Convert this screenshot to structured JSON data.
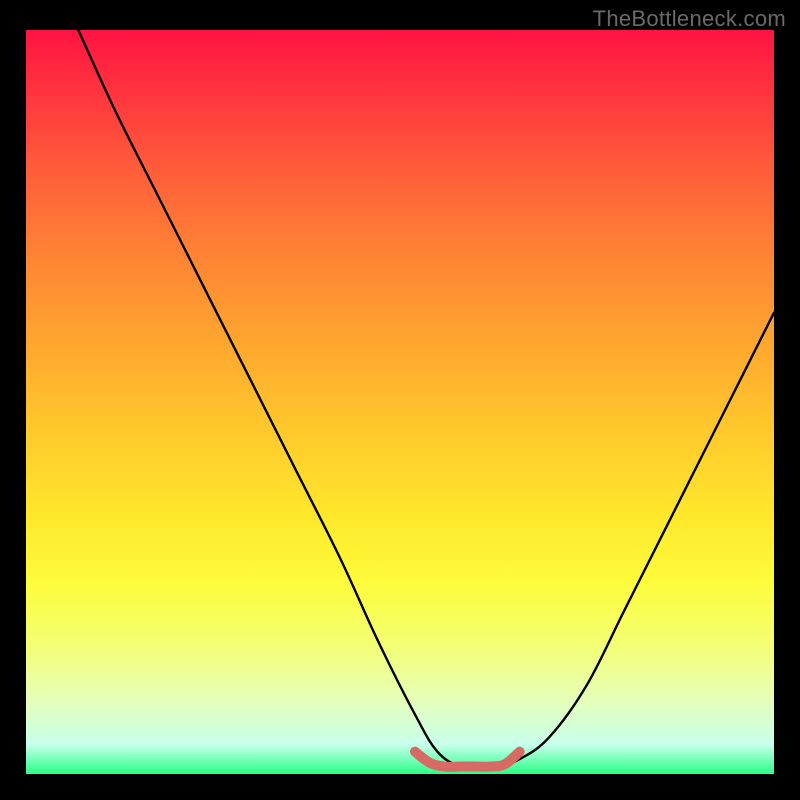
{
  "watermark": "TheBottleneck.com",
  "chart_data": {
    "type": "line",
    "title": "",
    "xlabel": "",
    "ylabel": "",
    "xlim": [
      0,
      100
    ],
    "ylim": [
      0,
      100
    ],
    "series": [
      {
        "name": "bottleneck-curve",
        "color": "#000000",
        "x": [
          7,
          12,
          18,
          24,
          30,
          36,
          42,
          47,
          52,
          55,
          58,
          60,
          63,
          66,
          70,
          75,
          80,
          86,
          92,
          100
        ],
        "y": [
          100,
          89,
          77,
          65,
          53,
          41,
          29,
          18,
          8,
          3,
          1,
          1,
          1,
          2,
          5,
          12,
          22,
          34,
          46,
          62
        ]
      },
      {
        "name": "optimal-band",
        "color": "#d86a66",
        "x": [
          52,
          54,
          56,
          58,
          60,
          62,
          64,
          66
        ],
        "y": [
          3.0,
          1.5,
          1.0,
          1.0,
          1.0,
          1.0,
          1.3,
          3.0
        ]
      }
    ],
    "gradient_stops": [
      {
        "pos": 0.0,
        "color": "#ff1342"
      },
      {
        "pos": 0.07,
        "color": "#ff2f3e"
      },
      {
        "pos": 0.18,
        "color": "#ff5a3b"
      },
      {
        "pos": 0.3,
        "color": "#ff8334"
      },
      {
        "pos": 0.42,
        "color": "#ffa62f"
      },
      {
        "pos": 0.54,
        "color": "#ffc92c"
      },
      {
        "pos": 0.65,
        "color": "#ffe72b"
      },
      {
        "pos": 0.74,
        "color": "#fdfb3a"
      },
      {
        "pos": 0.82,
        "color": "#f4ff6e"
      },
      {
        "pos": 0.9,
        "color": "#e6ffb8"
      },
      {
        "pos": 0.96,
        "color": "#c7ffec"
      },
      {
        "pos": 1.0,
        "color": "#29ff86"
      }
    ]
  }
}
